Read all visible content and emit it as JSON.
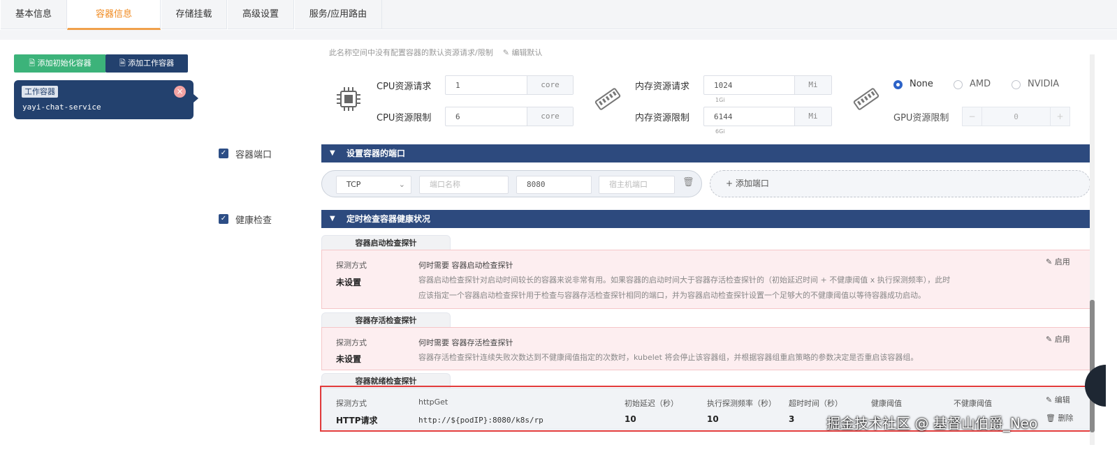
{
  "tabs": [
    {
      "label": "基本信息"
    },
    {
      "label": "容器信息"
    },
    {
      "label": "存储挂载"
    },
    {
      "label": "高级设置"
    },
    {
      "label": "服务/应用路由"
    }
  ],
  "container_actions": {
    "add_init": "添加初始化容器",
    "add_work": "添加工作容器"
  },
  "container_card": {
    "tag": "工作容器",
    "name": "yayi-chat-service"
  },
  "resources": {
    "top_note": "此名称空间中没有配置容器的默认资源请求/限制",
    "edit_default": "编辑默认",
    "cpu_request_label": "CPU资源请求",
    "cpu_request_value": "1",
    "cpu_limit_label": "CPU资源限制",
    "cpu_limit_value": "6",
    "cpu_unit": "core",
    "mem_request_label": "内存资源请求",
    "mem_request_value": "1024",
    "mem_request_hint": "1Gi",
    "mem_limit_label": "内存资源限制",
    "mem_limit_value": "6144",
    "mem_limit_hint": "6Gi",
    "mem_unit": "Mi",
    "gpu_options": [
      "None",
      "AMD",
      "NVIDIA"
    ],
    "gpu_selected": "None",
    "gpu_limit_label": "GPU资源限制",
    "gpu_limit_value": "0",
    "gpu_minus": "−",
    "gpu_plus": "+"
  },
  "ports": {
    "checkbox_label": "容器端口",
    "header": "设置容器的端口",
    "protocol": "TCP",
    "name_placeholder": "端口名称",
    "port_value": "8080",
    "host_port_placeholder": "宿主机端口",
    "add_label": "添加端口"
  },
  "health": {
    "checkbox_label": "健康检查",
    "header": "定时检查容器健康状况",
    "method_label": "探测方式",
    "enable_label": "启用",
    "edit_label": "编辑",
    "delete_label": "删除",
    "startup": {
      "title": "容器启动检查探针",
      "method": "未设置",
      "when_title": "何时需要 容器启动检查探针",
      "desc_line1": "容器启动检查探针对启动时间较长的容器来说非常有用。如果容器的启动时间大于容器存活检查探针的（初始延迟时间 + 不健康阈值 x 执行探测频率），此时",
      "desc_line2": "应该指定一个容器启动检查探针用于检查与容器存活检查探针相同的端口，并为容器启动检查探针设置一个足够大的不健康阈值以等待容器成功启动。"
    },
    "liveness": {
      "title": "容器存活检查探针",
      "method": "未设置",
      "when_title": "何时需要 容器存活检查探针",
      "desc_line1": "容器存活检查探针连续失败次数达到不健康阈值指定的次数时，kubelet 将会停止该容器组，并根据容器组重启策略的参数决定是否重启该容器组。"
    },
    "readiness": {
      "title": "容器就绪检查探针",
      "method": "HTTP请求",
      "type_label": "httpGet",
      "url": "http://${podIP}:8080/k8s/rp",
      "columns": [
        "初始延迟（秒）",
        "执行探测频率（秒）",
        "超时时间（秒）",
        "健康阈值",
        "不健康阈值"
      ],
      "values": [
        "10",
        "10",
        "3"
      ]
    }
  },
  "watermark": "掘金技术社区 @ 基督山伯爵_Neo"
}
